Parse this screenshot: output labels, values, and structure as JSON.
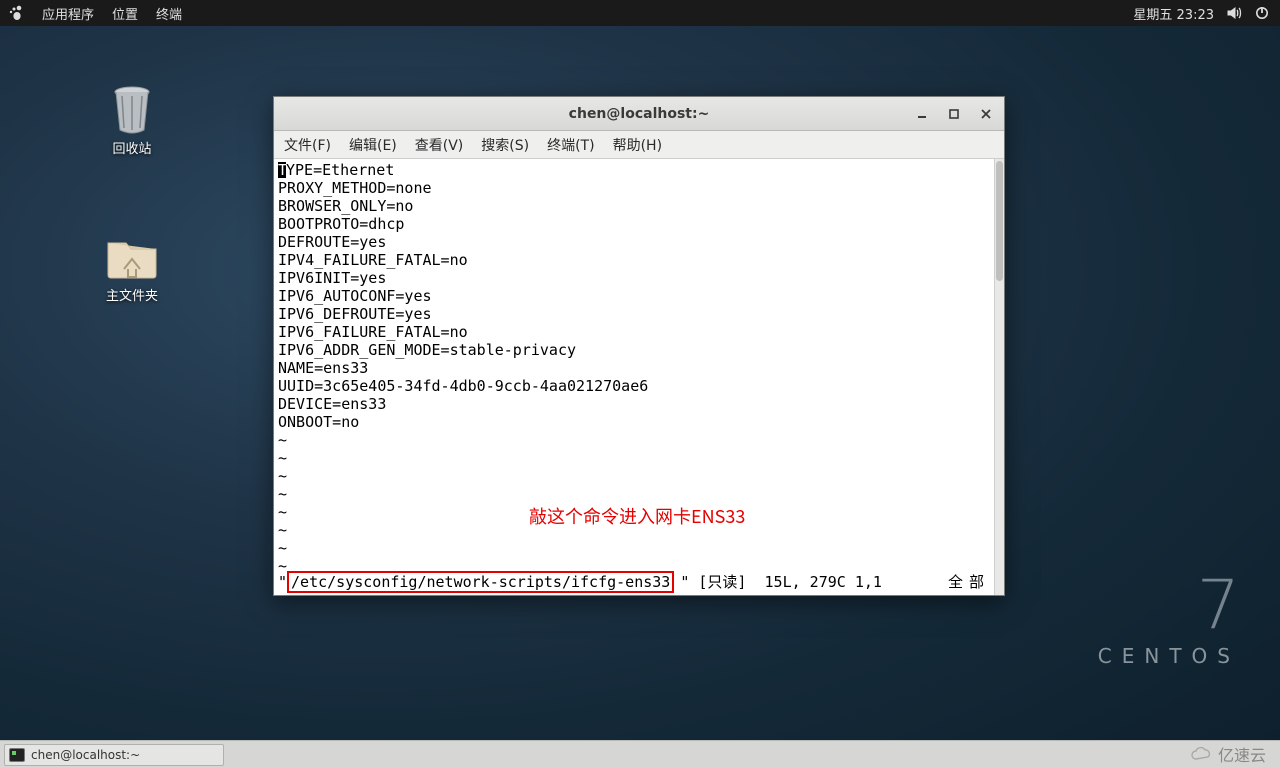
{
  "panel": {
    "apps": "应用程序",
    "places": "位置",
    "terminal": "终端",
    "datetime": "星期五 23:23"
  },
  "desktop_icons": {
    "trash": "回收站",
    "home": "主文件夹"
  },
  "branding": {
    "seven": "7",
    "centos": "CENTOS"
  },
  "taskbar": {
    "task1": "chen@localhost:~"
  },
  "watermark": "亿速云",
  "window": {
    "title": "chen@localhost:~",
    "menus": {
      "file": "文件(F)",
      "edit": "编辑(E)",
      "view": "查看(V)",
      "search": "搜索(S)",
      "terminal": "终端(T)",
      "help": "帮助(H)"
    },
    "cursor_letter": "T",
    "lines_after_cursor": "YPE=Ethernet",
    "lines": [
      "PROXY_METHOD=none",
      "BROWSER_ONLY=no",
      "BOOTPROTO=dhcp",
      "DEFROUTE=yes",
      "IPV4_FAILURE_FATAL=no",
      "IPV6INIT=yes",
      "IPV6_AUTOCONF=yes",
      "IPV6_DEFROUTE=yes",
      "IPV6_FAILURE_FATAL=no",
      "IPV6_ADDR_GEN_MODE=stable-privacy",
      "NAME=ens33",
      "UUID=3c65e405-34fd-4db0-9ccb-4aa021270ae6",
      "DEVICE=ens33",
      "ONBOOT=no"
    ],
    "tilde": "~",
    "annotation": "敲这个命令进入网卡ENS33",
    "status": {
      "quote_left": "\"",
      "file": "/etc/sysconfig/network-scripts/ifcfg-ens33",
      "quote_right": "\"",
      "readonly": " [只读]  15L, 279C 1,1",
      "right": "全部"
    }
  }
}
